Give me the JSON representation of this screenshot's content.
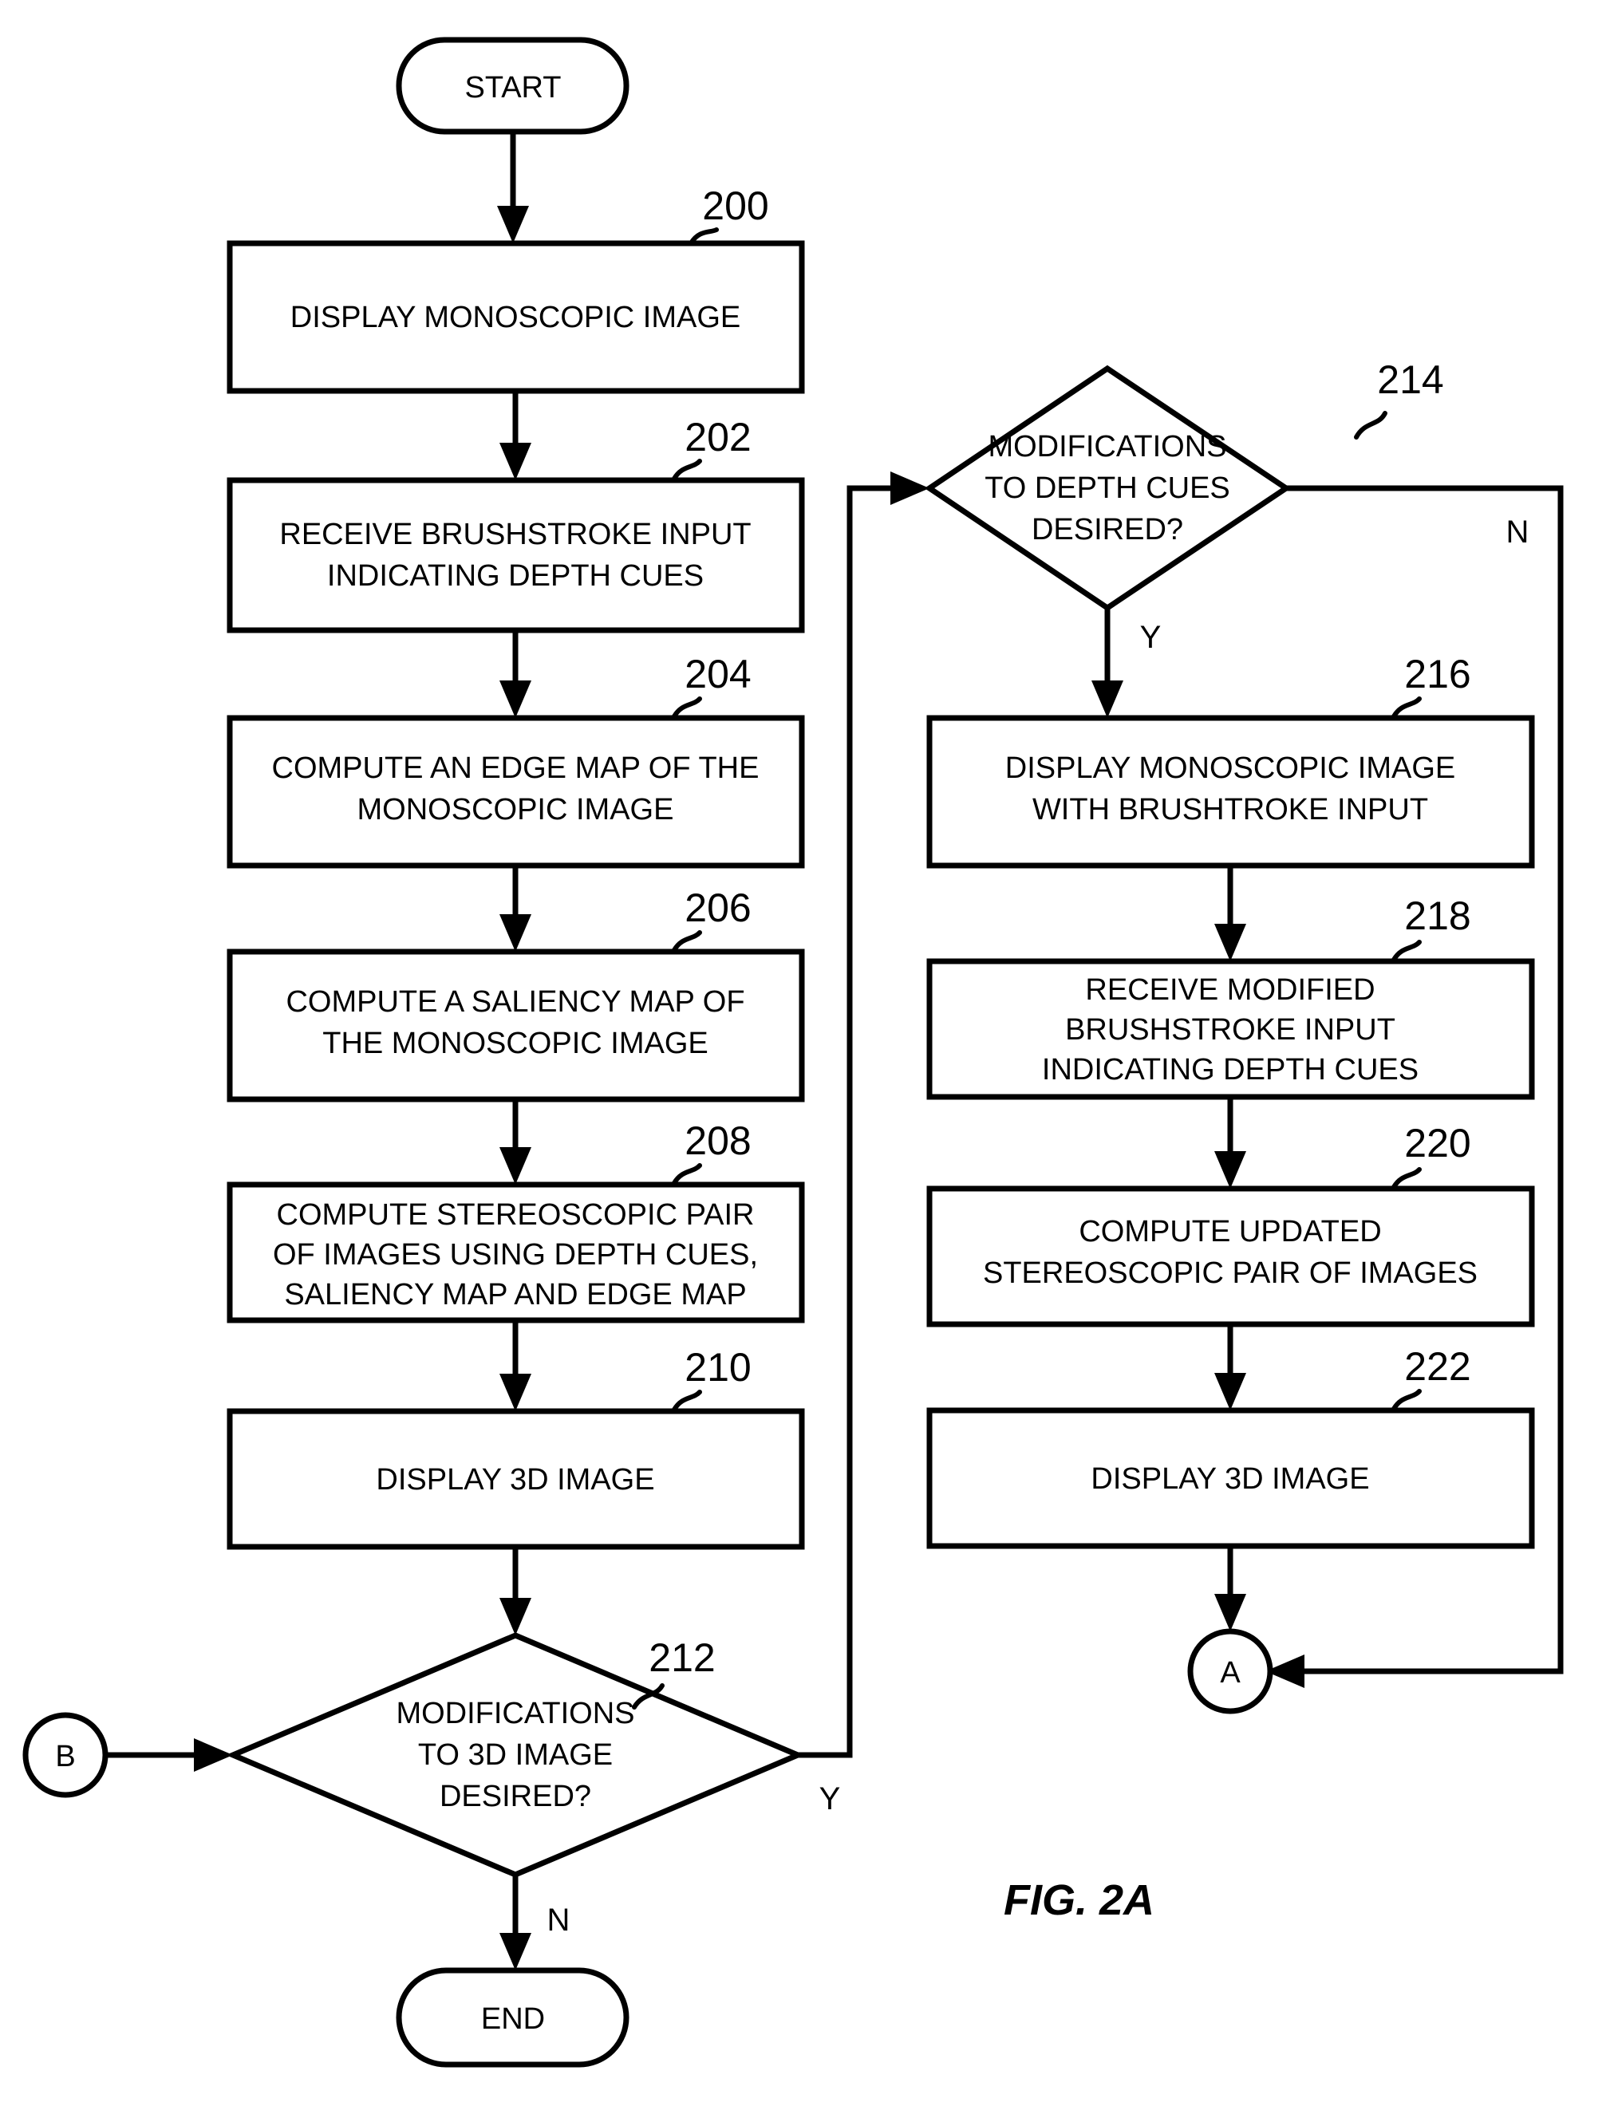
{
  "figure": {
    "label": "FIG. 2A",
    "type": "flowchart"
  },
  "terminators": {
    "start": "START",
    "end": "END"
  },
  "connectors": {
    "a": "A",
    "b": "B"
  },
  "branch_labels": {
    "yes": "Y",
    "no": "N"
  },
  "left_column": [
    {
      "ref": "200",
      "lines": [
        "DISPLAY MONOSCOPIC IMAGE"
      ]
    },
    {
      "ref": "202",
      "lines": [
        "RECEIVE BRUSHSTROKE INPUT",
        "INDICATING DEPTH CUES"
      ]
    },
    {
      "ref": "204",
      "lines": [
        "COMPUTE AN EDGE MAP OF THE",
        "MONOSCOPIC IMAGE"
      ]
    },
    {
      "ref": "206",
      "lines": [
        "COMPUTE A SALIENCY MAP OF",
        "THE MONOSCOPIC IMAGE"
      ]
    },
    {
      "ref": "208",
      "lines": [
        "COMPUTE STEREOSCOPIC PAIR",
        "OF IMAGES USING DEPTH CUES,",
        "SALIENCY MAP AND EDGE MAP"
      ]
    },
    {
      "ref": "210",
      "lines": [
        "DISPLAY 3D IMAGE"
      ]
    }
  ],
  "left_decision": {
    "ref": "212",
    "lines": [
      "MODIFICATIONS",
      "TO 3D IMAGE",
      "DESIRED?"
    ],
    "yes_label": "Y",
    "no_label": "N"
  },
  "right_decision": {
    "ref": "214",
    "lines": [
      "MODIFICATIONS",
      "TO DEPTH CUES",
      "DESIRED?"
    ],
    "yes_label": "Y",
    "no_label": "N"
  },
  "right_column": [
    {
      "ref": "216",
      "lines": [
        "DISPLAY MONOSCOPIC IMAGE",
        "WITH BRUSHTROKE INPUT"
      ]
    },
    {
      "ref": "218",
      "lines": [
        "RECEIVE MODIFIED",
        "BRUSHSTROKE INPUT",
        "INDICATING DEPTH CUES"
      ]
    },
    {
      "ref": "220",
      "lines": [
        "COMPUTE UPDATED",
        "STEREOSCOPIC PAIR OF IMAGES"
      ]
    },
    {
      "ref": "222",
      "lines": [
        "DISPLAY 3D IMAGE"
      ]
    }
  ],
  "colors": {
    "line": "#000000",
    "fill": "#ffffff",
    "text": "#000000"
  }
}
